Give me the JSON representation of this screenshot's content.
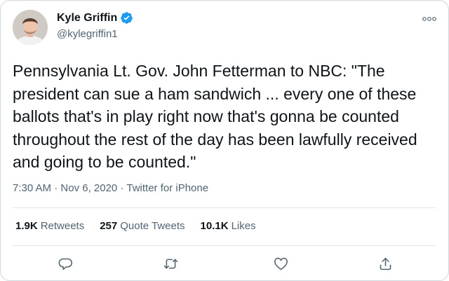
{
  "author": {
    "display_name": "Kyle Griffin",
    "handle": "@kylegriffin1",
    "verified": true
  },
  "tweet": {
    "text": "Pennsylvania Lt. Gov. John Fetterman to NBC: \"The president can sue a ham sandwich ... every one of these ballots that's in play right now that's gonna be counted throughout the rest of the day has been lawfully received and going to be counted.\"",
    "time": "7:30 AM",
    "separator": "·",
    "date": "Nov 6, 2020",
    "source": "Twitter for iPhone"
  },
  "stats": {
    "retweets_count": "1.9K",
    "retweets_label": "Retweets",
    "quote_count": "257",
    "quote_label": "Quote Tweets",
    "likes_count": "10.1K",
    "likes_label": "Likes"
  },
  "colors": {
    "verified_badge": "#1d9bf0",
    "secondary_text": "#536471",
    "primary_text": "#0f1419"
  },
  "icons": {
    "more": "more-icon",
    "reply": "reply-icon",
    "retweet": "retweet-icon",
    "like": "heart-icon",
    "share": "share-icon",
    "verified": "verified-badge-icon"
  }
}
